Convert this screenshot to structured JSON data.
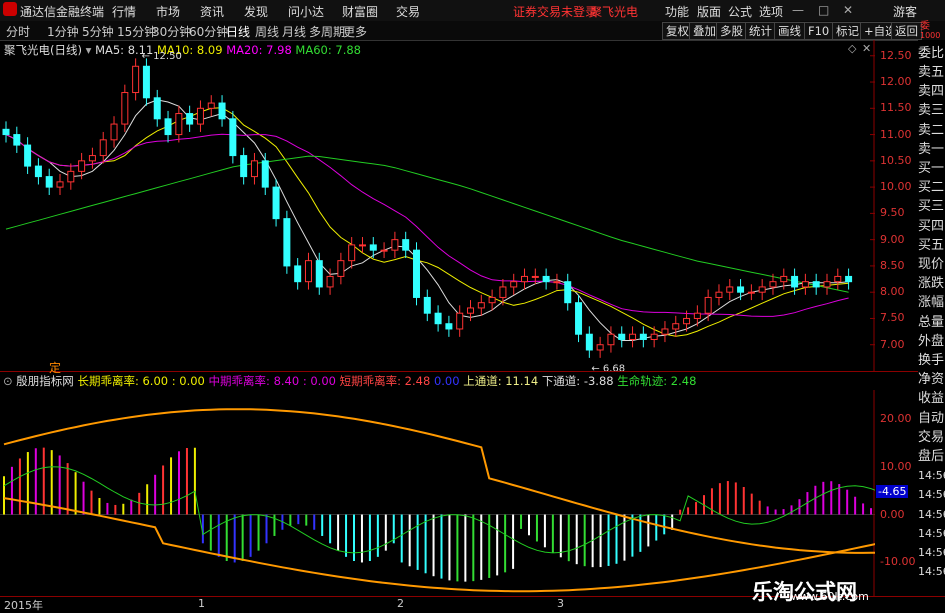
{
  "app": {
    "title": "通达信金融终端"
  },
  "menu": {
    "items": [
      "行情",
      "市场",
      "资讯",
      "发现",
      "问小达",
      "财富圈",
      "交易"
    ],
    "status": "证券交易未登录",
    "stock_short": "聚飞光电",
    "right": [
      "功能",
      "版面",
      "公式",
      "选项",
      "游客"
    ]
  },
  "toolbar": {
    "tabs": [
      "分时",
      "1分钟",
      "5分钟",
      "15分钟",
      "30分钟",
      "60分钟",
      "日线",
      "周线",
      "月线",
      "多周期",
      "更多"
    ],
    "buttons": [
      "复权",
      "叠加",
      "多股",
      "统计",
      "画线",
      "F10",
      "标记",
      "+自选",
      "返回"
    ]
  },
  "legend": {
    "stock": "聚飞光电(日线)",
    "ma5": "MA5: 8.11",
    "ma10": "MA10: 8.09",
    "ma20": "MA20: 7.98",
    "ma60": "MA60: 7.88",
    "high_label": "12.50",
    "low_label": "6.68"
  },
  "indicator": {
    "name": "殷朋指标网",
    "long": "长期乖离率: 6.00 : 0.00",
    "mid": "中期乖离率: 8.40 : 0.00",
    "short": "短期乖离率: 2.48",
    "v": "0.00",
    "upper": "上通道: 11.14",
    "lower": "下通道: -3.88",
    "life": "生命轨迹: 2.48",
    "marker": "定",
    "cur": "-4.65"
  },
  "right_panel": {
    "top": "委比",
    "items": [
      "卖五",
      "卖四",
      "卖三",
      "卖二",
      "卖一",
      "买一",
      "买二",
      "买三",
      "买四",
      "买五",
      "现价",
      "涨跌",
      "涨幅",
      "总量",
      "外盘",
      "换手",
      "净资",
      "收益",
      "自动",
      "交易",
      "盘后",
      "14:56",
      "14:56",
      "14:56",
      "14:56",
      "14:56",
      "14:56"
    ],
    "up": "委",
    "down": "1000"
  },
  "xaxis": [
    "2015年",
    "1",
    "2",
    "3"
  ],
  "watermark": {
    "title": "乐淘公式网",
    "url": "www.60lt.com"
  },
  "chart_data": [
    {
      "type": "candlestick",
      "title": "聚飞光电(日线)",
      "ylim": [
        6.5,
        12.8
      ],
      "yticks": [
        7.0,
        7.5,
        8.0,
        8.5,
        9.0,
        9.5,
        10.0,
        10.5,
        11.0,
        11.5,
        12.0,
        12.5
      ],
      "closes": [
        11.0,
        10.8,
        10.4,
        10.2,
        10.0,
        10.1,
        10.3,
        10.5,
        10.6,
        10.9,
        11.2,
        11.8,
        12.3,
        11.7,
        11.3,
        11.0,
        11.4,
        11.2,
        11.5,
        11.6,
        11.3,
        10.6,
        10.2,
        10.5,
        10.0,
        9.4,
        8.5,
        8.2,
        8.6,
        8.1,
        8.3,
        8.6,
        8.9,
        8.9,
        8.8,
        8.8,
        9.0,
        8.8,
        7.9,
        7.6,
        7.4,
        7.3,
        7.6,
        7.7,
        7.8,
        7.9,
        8.1,
        8.2,
        8.3,
        8.3,
        8.2,
        8.2,
        7.8,
        7.2,
        6.9,
        7.0,
        7.2,
        7.1,
        7.2,
        7.1,
        7.2,
        7.3,
        7.4,
        7.5,
        7.6,
        7.9,
        8.0,
        8.1,
        8.0,
        8.0,
        8.1,
        8.2,
        8.3,
        8.1,
        8.2,
        8.1,
        8.2,
        8.3,
        8.2
      ]
    },
    {
      "type": "bar",
      "title": "殷朋指标网",
      "ylim": [
        -17,
        26
      ],
      "yticks": [
        20,
        10,
        0,
        -10
      ]
    }
  ]
}
